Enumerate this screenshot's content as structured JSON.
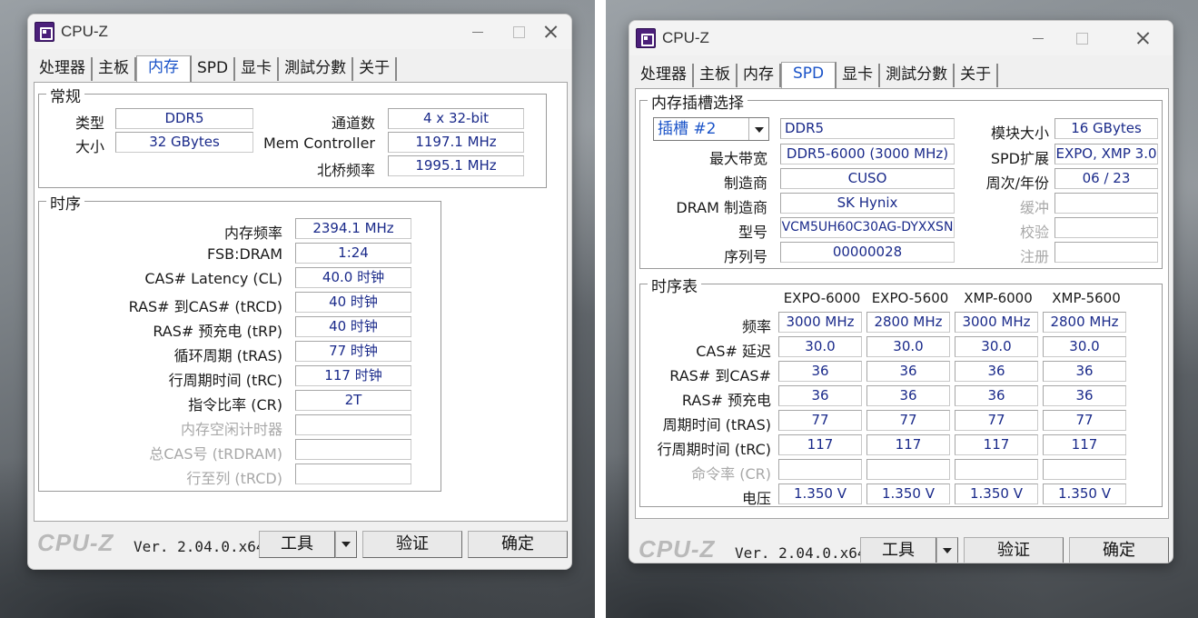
{
  "app_title": "CPU-Z",
  "tabs": [
    "处理器",
    "主板",
    "内存",
    "SPD",
    "显卡",
    "測試分數",
    "关于"
  ],
  "memory": {
    "general_title": "常规",
    "type_label": "类型",
    "type_value": "DDR5",
    "size_label": "大小",
    "size_value": "32 GBytes",
    "channels_label": "通道数",
    "channels_value": "4 x 32-bit",
    "memctrl_label": "Mem Controller",
    "memctrl_value": "1197.1 MHz",
    "nb_label": "北桥频率",
    "nb_value": "1995.1 MHz",
    "timings_title": "时序",
    "timings": [
      {
        "label": "内存频率",
        "value": "2394.1 MHz",
        "disabled": false
      },
      {
        "label": "FSB:DRAM",
        "value": "1:24",
        "disabled": false
      },
      {
        "label": "CAS# Latency (CL)",
        "value": "40.0 时钟",
        "disabled": false
      },
      {
        "label": "RAS# 到CAS# (tRCD)",
        "value": "40 时钟",
        "disabled": false
      },
      {
        "label": "RAS# 预充电 (tRP)",
        "value": "40 时钟",
        "disabled": false
      },
      {
        "label": "循环周期 (tRAS)",
        "value": "77 时钟",
        "disabled": false
      },
      {
        "label": "行周期时间 (tRC)",
        "value": "117 时钟",
        "disabled": false
      },
      {
        "label": "指令比率 (CR)",
        "value": "2T",
        "disabled": false
      },
      {
        "label": "内存空闲计时器",
        "value": "",
        "disabled": true
      },
      {
        "label": "总CAS号 (tRDRAM)",
        "value": "",
        "disabled": true
      },
      {
        "label": "行至列 (tRCD)",
        "value": "",
        "disabled": true
      }
    ]
  },
  "spd": {
    "slot_title": "内存插槽选择",
    "slot_value": "插槽 #2",
    "type_value": "DDR5",
    "module_size_label": "模块大小",
    "module_size_value": "16 GBytes",
    "max_bw_label": "最大带宽",
    "max_bw_value": "DDR5-6000 (3000 MHz)",
    "spd_ext_label": "SPD扩展",
    "spd_ext_value": "EXPO, XMP 3.0",
    "mfr_label": "制造商",
    "mfr_value": "CUSO",
    "week_year_label": "周次/年份",
    "week_year_value": "06 / 23",
    "dram_mfr_label": "DRAM 制造商",
    "dram_mfr_value": "SK Hynix",
    "buffer_label": "缓冲",
    "part_label": "型号",
    "part_value": "VCM5UH60C30AG-DYXXSN",
    "check_label": "校验",
    "serial_label": "序列号",
    "serial_value": "00000028",
    "reg_label": "注册",
    "timing_table_title": "时序表",
    "columns": [
      "EXPO-6000",
      "EXPO-5600",
      "XMP-6000",
      "XMP-5600"
    ],
    "rows": [
      {
        "label": "频率",
        "values": [
          "3000 MHz",
          "2800 MHz",
          "3000 MHz",
          "2800 MHz"
        ],
        "disabled": false
      },
      {
        "label": "CAS# 延迟",
        "values": [
          "30.0",
          "30.0",
          "30.0",
          "30.0"
        ],
        "disabled": false
      },
      {
        "label": "RAS# 到CAS#",
        "values": [
          "36",
          "36",
          "36",
          "36"
        ],
        "disabled": false
      },
      {
        "label": "RAS# 预充电",
        "values": [
          "36",
          "36",
          "36",
          "36"
        ],
        "disabled": false
      },
      {
        "label": "周期时间 (tRAS)",
        "values": [
          "77",
          "77",
          "77",
          "77"
        ],
        "disabled": false
      },
      {
        "label": "行周期时间 (tRC)",
        "values": [
          "117",
          "117",
          "117",
          "117"
        ],
        "disabled": false
      },
      {
        "label": "命令率 (CR)",
        "values": [
          "",
          "",
          "",
          ""
        ],
        "disabled": true
      },
      {
        "label": "电压",
        "values": [
          "1.350 V",
          "1.350 V",
          "1.350 V",
          "1.350 V"
        ],
        "disabled": false
      }
    ]
  },
  "footer": {
    "logo": "CPU-Z",
    "version": "Ver. 2.04.0.x64",
    "tools_label": "工具",
    "validate_label": "验证",
    "ok_label": "确定"
  }
}
